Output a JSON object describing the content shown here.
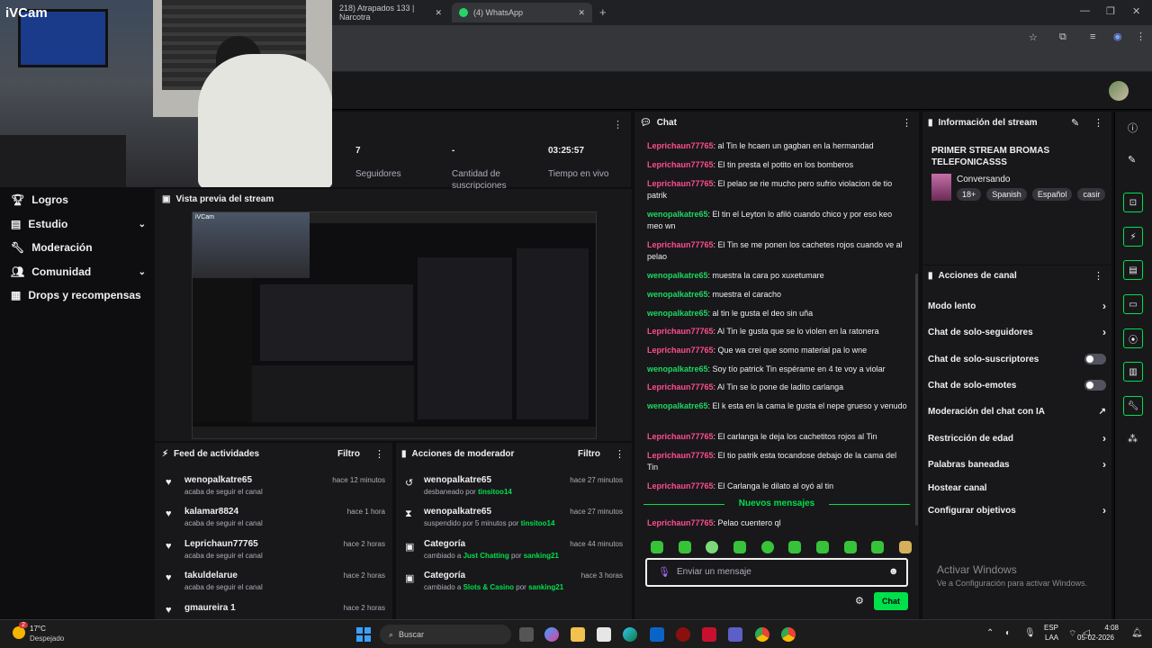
{
  "browser": {
    "tabs": [
      {
        "label": "218) Atrapados 133 | Narcotra"
      },
      {
        "label": "(4) WhatsApp"
      }
    ]
  },
  "webcam": {
    "logo": "iVCam"
  },
  "leftnav": {
    "items": [
      {
        "label": "Logros",
        "icon": "trophy-icon",
        "has_chevron": false
      },
      {
        "label": "Estudio",
        "icon": "studio-icon",
        "has_chevron": true
      },
      {
        "label": "Moderación",
        "icon": "wrench-icon",
        "has_chevron": false
      },
      {
        "label": "Comunidad",
        "icon": "community-icon",
        "has_chevron": true
      },
      {
        "label": "Drops y recompensas",
        "icon": "drops-icon",
        "has_chevron": false
      }
    ]
  },
  "stats": [
    {
      "value": "7",
      "label": "Seguidores"
    },
    {
      "value": "-",
      "label": "Cantidad de suscripciones"
    },
    {
      "value": "03:25:57",
      "label": "Tiempo en vivo"
    }
  ],
  "preview": {
    "title": "Vista previa del stream",
    "logo": "iVCam"
  },
  "feed": {
    "title": "Feed de actividades",
    "filter": "Filtro",
    "entries": [
      {
        "name": "wenopalkatre65",
        "sub": "acaba de seguir el canal",
        "time": "hace 12 minutos"
      },
      {
        "name": "kalamar8824",
        "sub": "acaba de seguir el canal",
        "time": "hace 1 hora"
      },
      {
        "name": "Leprichaun77765",
        "sub": "acaba de seguir el canal",
        "time": "hace 2 horas"
      },
      {
        "name": "takuldelarue",
        "sub": "acaba de seguir el canal",
        "time": "hace 2 horas"
      },
      {
        "name": "gmaureira 1",
        "sub": "",
        "time": "hace 2 horas"
      }
    ]
  },
  "modactions": {
    "title": "Acciones de moderador",
    "filter": "Filtro",
    "entries": [
      {
        "name": "wenopalkatre65",
        "sub_pre": "desbaneado por",
        "sub_user": "tinsitoo14",
        "sub_mid": "",
        "sub_game": "",
        "sub_by": "",
        "time": "hace 27 minutos",
        "icon": "undo-icon"
      },
      {
        "name": "wenopalkatre65",
        "sub_pre": "suspendido por 5 minutos por",
        "sub_user": "tinsitoo14",
        "sub_mid": "",
        "sub_game": "",
        "sub_by": "",
        "time": "hace 27 minutos",
        "icon": "hourglass-icon"
      },
      {
        "name": "Categoría",
        "sub_pre": "cambiado a",
        "sub_user": "",
        "sub_mid": "por",
        "sub_game": "Just Chatting",
        "sub_by": "sanking21",
        "time": "hace 44 minutos",
        "icon": "category-icon"
      },
      {
        "name": "Categoría",
        "sub_pre": "cambiado a",
        "sub_user": "",
        "sub_mid": "por",
        "sub_game": "Slots & Casino",
        "sub_by": "sanking21",
        "time": "hace 3 horas",
        "icon": "category-icon"
      }
    ]
  },
  "chat": {
    "title": "Chat",
    "messages": [
      {
        "user": "Leprichaun77765",
        "color": "pink",
        "text": ": al Tin le hcaen un gagban en la hermandad"
      },
      {
        "user": "Leprichaun77765",
        "color": "pink",
        "text": ": El tin presta el potito en los bomberos"
      },
      {
        "user": "Leprichaun77765",
        "color": "pink",
        "text": ": El pelao se rie mucho pero sufrio violacion de tio patrik"
      },
      {
        "user": "wenopalkatre65",
        "color": "green",
        "text": ": El tin el Leyton lo afiló cuando chico y por eso keo meo wn"
      },
      {
        "user": "Leprichaun77765",
        "color": "pink",
        "text": ": El Tin se me ponen los cachetes rojos cuando ve al pelao"
      },
      {
        "user": "wenopalkatre65",
        "color": "green",
        "text": ": muestra la cara po xuxetumare"
      },
      {
        "user": "wenopalkatre65",
        "color": "green",
        "text": ": muestra el caracho"
      },
      {
        "user": "wenopalkatre65",
        "color": "green",
        "text": ": al tin le gusta el deo sin uña"
      },
      {
        "user": "Leprichaun77765",
        "color": "pink",
        "text": ": Al Tin le gusta que se lo violen en la ratonera"
      },
      {
        "user": "Leprichaun77765",
        "color": "pink",
        "text": ": Que wa crei que somo material pa lo wne"
      },
      {
        "user": "wenopalkatre65",
        "color": "green",
        "text": ": Soy tío patrick Tin espérame en 4 te voy a violar"
      },
      {
        "user": "Leprichaun77765",
        "color": "pink",
        "text": ": Al Tin se lo pone de ladito carlanga"
      },
      {
        "user": "wenopalkatre65",
        "color": "green",
        "text": ": El k esta en la cama le gusta el nepe grueso y venudo"
      },
      {
        "user": "Leprichaun77765",
        "color": "pink",
        "text": ": El carlanga le deja los cachetitos rojos al Tin"
      },
      {
        "user": "Leprichaun77765",
        "color": "pink",
        "text": ": El tio patrik esta tocandose debajo de la cama del Tin"
      },
      {
        "user": "Leprichaun77765",
        "color": "pink",
        "text": ": El Carlanga le dilato al oyó al tin"
      }
    ],
    "new_messages": "Nuevos mensajes",
    "last_message": {
      "user": "Leprichaun77765",
      "text": ": Pelao cuentero ql"
    },
    "input_placeholder": "Enviar un mensaje",
    "send_label": "Chat"
  },
  "stream_info": {
    "title": "Información del stream",
    "stream_title": "PRIMER STREAM BROMAS TELEFONICASSS",
    "category": "Conversando",
    "tags": [
      "18+",
      "Spanish",
      "Español",
      "casir"
    ]
  },
  "channel_actions": {
    "title": "Acciones de canal",
    "items": [
      {
        "label": "Modo lento",
        "control": "chevron"
      },
      {
        "label": "Chat de solo-seguidores",
        "control": "chevron"
      },
      {
        "label": "Chat de solo-suscriptores",
        "control": "toggle"
      },
      {
        "label": "Chat de solo-emotes",
        "control": "toggle"
      },
      {
        "label": "Moderación del chat con IA",
        "control": "external"
      },
      {
        "label": "Restricción de edad",
        "control": "chevron"
      },
      {
        "label": "Palabras baneadas",
        "control": "chevron"
      },
      {
        "label": "Hostear canal",
        "control": "none"
      },
      {
        "label": "Configurar objetivos",
        "control": "chevron"
      }
    ]
  },
  "watermark": {
    "title": "Activar Windows",
    "sub": "Ve a Configuración para activar Windows."
  },
  "taskbar": {
    "weather_temp": "17°C",
    "weather_desc": "Despejado",
    "weather_badge": "2",
    "search": "Buscar",
    "lang_top": "ESP",
    "lang_bottom": "LAA",
    "time": "4:08",
    "date": "05-02-2026"
  },
  "colors": {
    "accent": "#00e04b",
    "pink_user": "#ff4d8d",
    "green_user": "#1ed760"
  }
}
